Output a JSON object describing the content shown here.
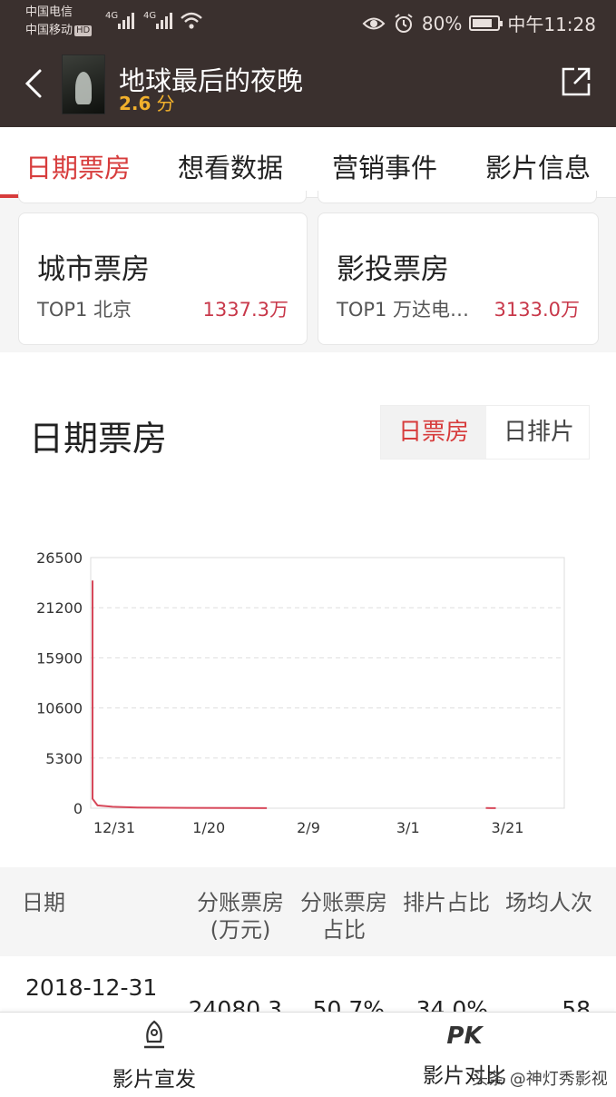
{
  "status_bar": {
    "carrier1": "中国电信",
    "carrier2": "中国移动",
    "hd": "HD",
    "signal1": "4G",
    "signal2": "4G",
    "battery": "80%",
    "battery_level": 0.8,
    "time": "中午11:28"
  },
  "header": {
    "title": "地球最后的夜晚",
    "score": "2.6",
    "score_unit": "分"
  },
  "tabs": [
    {
      "label": "日期票房",
      "active": true
    },
    {
      "label": "想看数据",
      "active": false
    },
    {
      "label": "营销事件",
      "active": false
    },
    {
      "label": "影片信息",
      "active": false
    }
  ],
  "cards": [
    {
      "title": "城市票房",
      "sub": "TOP1 北京",
      "value": "1337.3万"
    },
    {
      "title": "影投票房",
      "sub": "TOP1 万达电…",
      "value": "3133.0万"
    }
  ],
  "section": {
    "title": "日期票房",
    "toggle_on": "日票房",
    "toggle_off": "日排片"
  },
  "chart_data": {
    "type": "line",
    "color": "#d7485a",
    "y_ticks": [
      "26500",
      "21200",
      "15900",
      "10600",
      "5300",
      "0"
    ],
    "x_ticks": [
      "12/31",
      "1/20",
      "2/9",
      "3/1",
      "3/21"
    ],
    "ylim": [
      0,
      26500
    ],
    "grid": true,
    "series": [
      {
        "x": [
          "12/31",
          "1/1",
          "1/2",
          "1/5",
          "1/10",
          "1/20",
          "1/30",
          "2/5",
          "3/20",
          "3/21",
          "3/22",
          "3/23"
        ],
        "y": [
          24080.3,
          1000,
          300,
          150,
          80,
          40,
          20,
          10,
          null,
          15,
          10,
          5
        ]
      }
    ]
  },
  "table": {
    "headers": [
      "日期",
      "分账票房\n(万元)",
      "分账票房\n占比",
      "排片占比",
      "场均人次"
    ],
    "rows": [
      {
        "date": "2018-12-31",
        "box": "24080.3",
        "box_ratio": "50.7%",
        "screen_ratio": "34.0%",
        "avg": "58"
      }
    ]
  },
  "bottom_bar": {
    "left_label": "影片宣发",
    "right_label": "影片对比",
    "pk": "PK"
  },
  "watermark": "头条 @神灯秀影视"
}
